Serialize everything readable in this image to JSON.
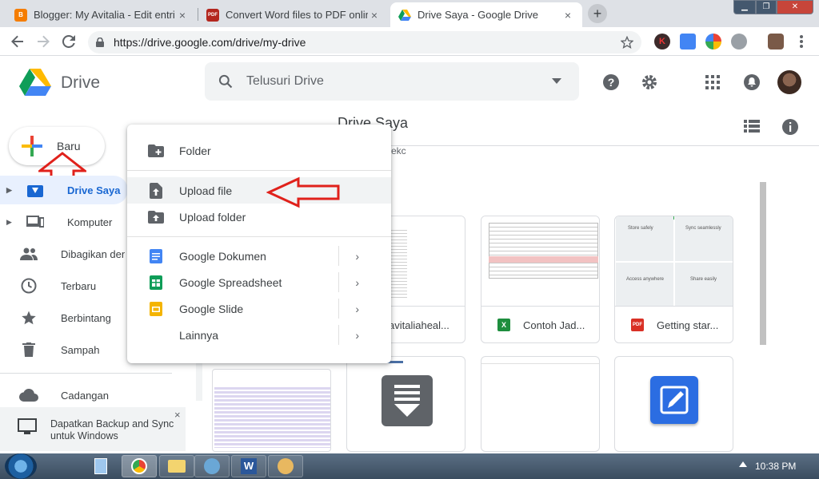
{
  "browser": {
    "tabs": [
      {
        "title": "Blogger: My Avitalia - Edit entri",
        "favicon": "blogger-icon"
      },
      {
        "title": "Convert Word files to PDF online",
        "favicon": "pdf-icon"
      },
      {
        "title": "Drive Saya - Google Drive",
        "favicon": "drive-icon"
      }
    ],
    "url": "https://drive.google.com/drive/my-drive",
    "close_glyph": "×",
    "new_tab_glyph": "+",
    "pdf_favicon_text": "PDF"
  },
  "header": {
    "app_name": "Drive",
    "search_placeholder": "Telusuri Drive"
  },
  "sidebar": {
    "new_button": "Baru",
    "items": [
      {
        "label": "Drive Saya",
        "icon": "my-drive-icon",
        "selected": true
      },
      {
        "label": "Komputer",
        "icon": "computer-icon"
      },
      {
        "label": "Dibagikan dengan saya",
        "icon": "shared-icon"
      },
      {
        "label": "Terbaru",
        "icon": "clock-icon"
      },
      {
        "label": "Berbintang",
        "icon": "star-icon"
      },
      {
        "label": "Sampah",
        "icon": "trash-icon"
      },
      {
        "label": "Cadangan",
        "icon": "cloud-icon"
      }
    ],
    "banner": {
      "line1": "Dapatkan Backup and Sync",
      "line2": "untuk Windows"
    }
  },
  "main": {
    "title": "Drive Saya",
    "partial_label": "ekc",
    "files": [
      {
        "name": "avitaliaheal...",
        "type": "doc"
      },
      {
        "name": "Contoh Jad...",
        "type": "sheet",
        "icon_text": "X"
      },
      {
        "name": "Getting star...",
        "type": "pdf",
        "icon_text": "PDF"
      }
    ],
    "getting_started_thumb": [
      "Store safely",
      "Sync seamlessly",
      "Access anywhere",
      "Share easily"
    ]
  },
  "menu": {
    "items": [
      {
        "label": "Folder",
        "icon": "new-folder-icon"
      },
      {
        "label": "Upload file",
        "icon": "upload-file-icon",
        "highlighted": true
      },
      {
        "label": "Upload folder",
        "icon": "upload-folder-icon"
      },
      {
        "label": "Google Dokumen",
        "icon": "docs-icon",
        "submenu": true
      },
      {
        "label": "Google Spreadsheet",
        "icon": "sheets-icon",
        "submenu": true
      },
      {
        "label": "Google Slide",
        "icon": "slides-icon",
        "submenu": true
      },
      {
        "label": "Lainnya",
        "icon": "",
        "submenu": true
      }
    ],
    "chevron": "›"
  },
  "taskbar": {
    "clock": "10:38 PM"
  },
  "colors": {
    "accent_blue": "#1967d2",
    "annotation_red": "#e0211b"
  }
}
